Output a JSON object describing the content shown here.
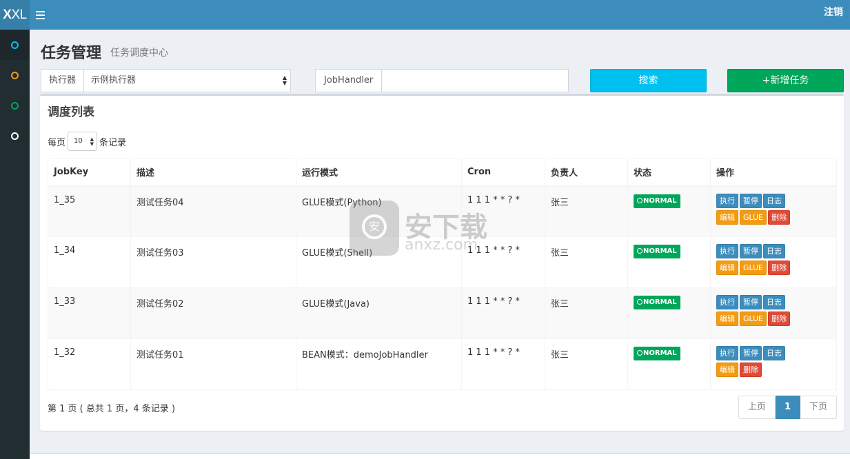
{
  "app": {
    "logo_bold": "X",
    "logo_rest": "XL"
  },
  "header": {
    "logout_label": "注销"
  },
  "sidebar": {
    "items": [
      {
        "name": "sidebar-item-1",
        "color": "#00c0ef"
      },
      {
        "name": "sidebar-item-2",
        "color": "#f39c12"
      },
      {
        "name": "sidebar-item-3",
        "color": "#00a65a"
      },
      {
        "name": "sidebar-item-4",
        "color": "#ffffff"
      }
    ]
  },
  "page": {
    "title": "任务管理",
    "subtitle": "任务调度中心"
  },
  "filters": {
    "executor_label": "执行器",
    "executor_value": "示例执行器",
    "jobhandler_label": "JobHandler",
    "jobhandler_value": "",
    "search_button": "搜索",
    "add_button": "+新增任务"
  },
  "box": {
    "title": "调度列表",
    "length_prefix": "每页",
    "length_value": "10",
    "length_suffix": "条记录"
  },
  "table": {
    "headers": [
      "JobKey",
      "描述",
      "运行模式",
      "Cron",
      "负责人",
      "状态",
      "操作"
    ],
    "rows": [
      {
        "jobkey": "1_35",
        "desc": "测试任务04",
        "mode": "GLUE模式(Python)",
        "cron": "1 1 1 * * ? *",
        "owner": "张三",
        "status": "NORMAL",
        "has_glue": true
      },
      {
        "jobkey": "1_34",
        "desc": "测试任务03",
        "mode": "GLUE模式(Shell)",
        "cron": "1 1 1 * * ? *",
        "owner": "张三",
        "status": "NORMAL",
        "has_glue": true
      },
      {
        "jobkey": "1_33",
        "desc": "测试任务02",
        "mode": "GLUE模式(Java)",
        "cron": "1 1 1 * * ? *",
        "owner": "张三",
        "status": "NORMAL",
        "has_glue": true
      },
      {
        "jobkey": "1_32",
        "desc": "测试任务01",
        "mode": "BEAN模式：demoJobHandler",
        "cron": "1 1 1 * * ? *",
        "owner": "张三",
        "status": "NORMAL",
        "has_glue": false
      }
    ],
    "actions": {
      "run": "执行",
      "pause": "暂停",
      "log": "日志",
      "edit": "编辑",
      "glue": "GLUE",
      "delete": "删除"
    }
  },
  "pagination": {
    "info": "第 1 页 ( 总共 1 页，4 条记录 )",
    "prev": "上页",
    "current": "1",
    "next": "下页"
  },
  "watermark": {
    "text": "安下载",
    "sub": "anxz.com",
    "shield_char": "安"
  }
}
